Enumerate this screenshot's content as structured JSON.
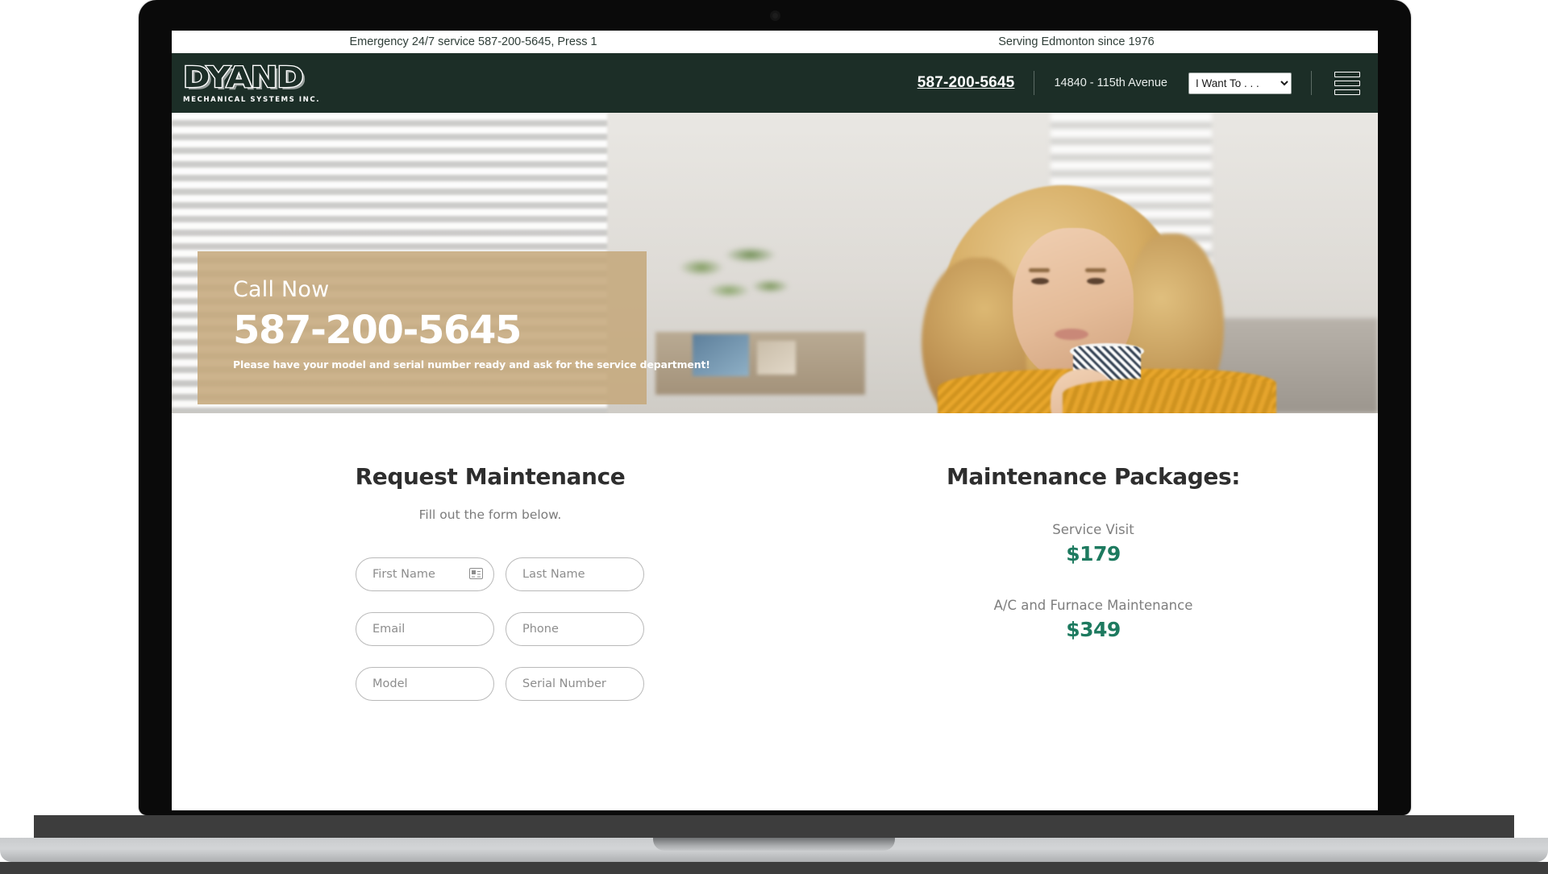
{
  "announcement": {
    "left": "Emergency 24/7 service 587-200-5645, Press 1",
    "right": "Serving Edmonton since 1976"
  },
  "header": {
    "logo_wordmark": "DYAND",
    "logo_tagline": "MECHANICAL SYSTEMS INC.",
    "phone": "587-200-5645",
    "address": "14840 - 115th Avenue",
    "select_value": "I Want To . . .",
    "select_options": [
      "I Want To . . ."
    ],
    "menu_icon": "hamburger-menu-icon",
    "brand_color": "#1c2e27"
  },
  "hero": {
    "kicker": "Call Now",
    "phone": "587-200-5645",
    "note": "Please have your model and serial number ready and ask for the service department!",
    "overlay_color": "#c5a87c"
  },
  "form": {
    "title": "Request Maintenance",
    "subtitle": "Fill out the form below.",
    "fields": [
      {
        "name": "first-name",
        "placeholder": "First Name",
        "value": "",
        "icon": "contact-card-icon"
      },
      {
        "name": "last-name",
        "placeholder": "Last Name",
        "value": ""
      },
      {
        "name": "email",
        "placeholder": "Email",
        "value": ""
      },
      {
        "name": "phone",
        "placeholder": "Phone",
        "value": ""
      },
      {
        "name": "model",
        "placeholder": "Model",
        "value": ""
      },
      {
        "name": "serial",
        "placeholder": "Serial Number",
        "value": ""
      }
    ]
  },
  "packages": {
    "title": "Maintenance Packages:",
    "price_color": "#1d7a5f",
    "items": [
      {
        "name": "Service Visit",
        "price": "$179"
      },
      {
        "name": "A/C and Furnace Maintenance",
        "price": "$349"
      }
    ]
  }
}
